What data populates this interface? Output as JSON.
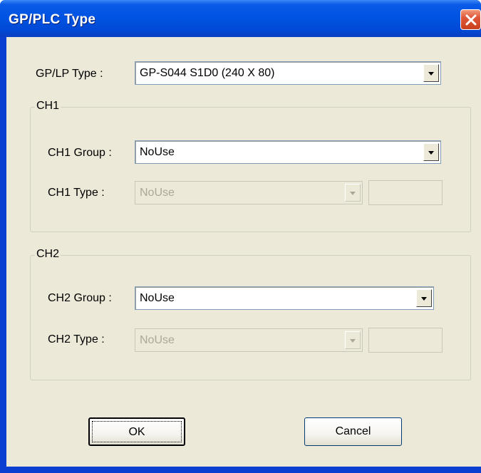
{
  "window": {
    "title": "GP/PLC Type"
  },
  "main": {
    "gp_type_label": "GP/LP Type :",
    "gp_type_value": "GP-S044  S1D0  (240 X 80)"
  },
  "ch1": {
    "legend": "CH1",
    "group_label": "CH1 Group :",
    "group_value": "NoUse",
    "type_label": "CH1 Type :",
    "type_value": "NoUse",
    "type_extra_value": ""
  },
  "ch2": {
    "legend": "CH2",
    "group_label": "CH2 Group :",
    "group_value": "NoUse",
    "type_label": "CH2 Type :",
    "type_value": "NoUse",
    "type_extra_value": ""
  },
  "buttons": {
    "ok_label": "OK",
    "cancel_label": "Cancel"
  },
  "icons": {
    "close": "close-icon",
    "dropdown": "chevron-down-icon"
  },
  "colors": {
    "titlebar": "#0054e3",
    "client_background": "#ece9d8",
    "close_button": "#e0563a",
    "disabled_text": "#aca899"
  }
}
